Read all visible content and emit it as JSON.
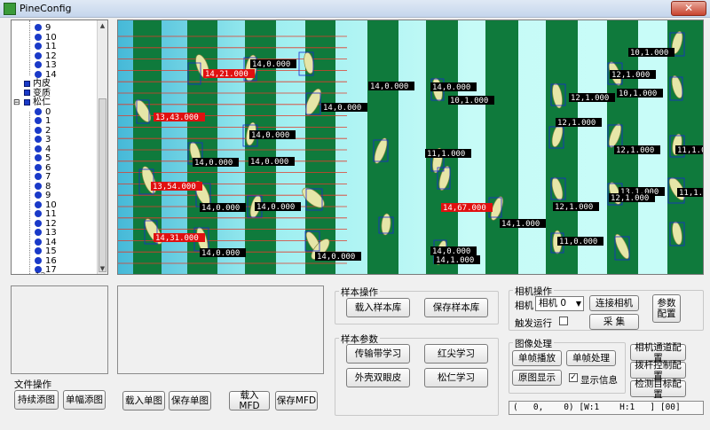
{
  "window": {
    "title": "PineConfig",
    "close_label": "✕"
  },
  "tree": {
    "items_top": [
      "9",
      "10",
      "11",
      "12",
      "13",
      "14"
    ],
    "category_1": "内皮",
    "category_2": "变质",
    "category_3": "松仁",
    "items_bottom": [
      "0",
      "1",
      "2",
      "3",
      "4",
      "5",
      "6",
      "7",
      "8",
      "9",
      "10",
      "11",
      "12",
      "13",
      "14",
      "15",
      "16",
      "17"
    ],
    "cut_off": "12"
  },
  "detections": [
    {
      "label": "14,0.000"
    },
    {
      "label": "14,0.000"
    },
    {
      "label": "14,0.000"
    },
    {
      "label": "14,0.000"
    },
    {
      "label": "14,0.000"
    },
    {
      "label": "14,0.000"
    },
    {
      "label": "14,0.000"
    },
    {
      "label": "14,0.000"
    },
    {
      "label": "14,0.000"
    },
    {
      "label": "14,0.000"
    },
    {
      "label": "14,0.000"
    },
    {
      "label": "14,0.000"
    },
    {
      "label": "14,1.000"
    },
    {
      "label": "14,1.000"
    },
    {
      "label": "13,1.000"
    },
    {
      "label": "12,1.000"
    },
    {
      "label": "12,1.000"
    },
    {
      "label": "12,1.000"
    },
    {
      "label": "12,1.000"
    },
    {
      "label": "12,1.000"
    },
    {
      "label": "12,1.000"
    },
    {
      "label": "11,1.000"
    },
    {
      "label": "11,1.000"
    },
    {
      "label": "11,1.000"
    },
    {
      "label": "11,0.000"
    },
    {
      "label": "10,1.000"
    },
    {
      "label": "10,1.000"
    },
    {
      "label": "10,1.000"
    }
  ],
  "detections_red": [
    {
      "label": "14,21.000"
    },
    {
      "label": "13,43.000"
    },
    {
      "label": "13,54.000"
    },
    {
      "label": "14,31.000"
    },
    {
      "label": "14,67.000"
    }
  ],
  "file_ops": {
    "title": "文件操作",
    "continuous_add": "持续添图",
    "single_add": "单幅添图",
    "load_single": "载入单图",
    "save_single": "保存单图",
    "load_mfd": "载入MFD",
    "save_mfd": "保存MFD"
  },
  "sample_ops": {
    "title": "样本操作",
    "load_lib": "载入样本库",
    "save_lib": "保存样本库"
  },
  "sample_params": {
    "title": "样本参数",
    "belt_learn": "传输带学习",
    "tip_learn": "红尖学习",
    "shell_learn": "外壳双眼皮",
    "kernel_learn": "松仁学习"
  },
  "camera_ops": {
    "title": "相机操作",
    "camera_label": "相机",
    "camera_select": "相机 0",
    "connect": "连接相机",
    "params_line1": "参数",
    "params_line2": "配置",
    "trigger": "触发运行",
    "capture": "采    集"
  },
  "image_proc": {
    "title": "图像处理",
    "single_play": "单帧播放",
    "single_proc": "单帧处理",
    "orig_show": "原图显示",
    "show_info": "显示信息",
    "show_info_checked": "✓"
  },
  "right_buttons": {
    "camera_channel": "相机通道配置",
    "kicker": "拨杆控制配置",
    "detect_target": "检测目标配置"
  },
  "status": {
    "text": "(   0,    0) [W:1    H:1   ] [00]"
  },
  "colors": {
    "belt_green": "#0f7a3c",
    "belt_light": "#b6f1f1",
    "label_red": "#e01010"
  }
}
